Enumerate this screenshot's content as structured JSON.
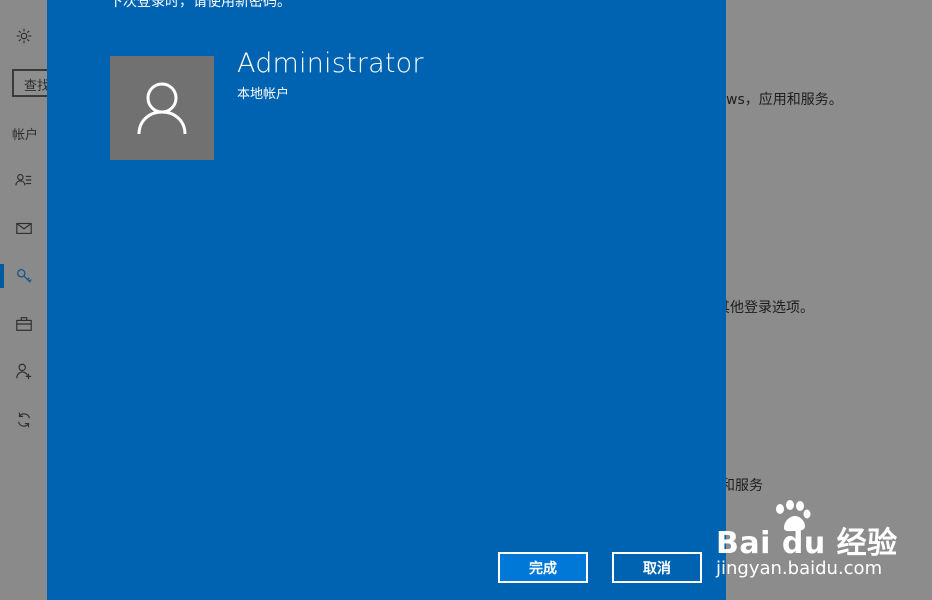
{
  "sidebar": {
    "search_text": "查找",
    "section_label": "帐户",
    "icons": [
      "gear-icon",
      "account-info-icon",
      "mail-icon",
      "key-icon",
      "briefcase-icon",
      "add-person-icon",
      "sync-icon"
    ]
  },
  "background": {
    "line1": "ws，应用和服务。",
    "line2": "其他登录选项。",
    "line3": "和服务"
  },
  "dialog": {
    "message": "下次登录时，请使用新密码。",
    "user_name": "Administrator",
    "account_type": "本地帐户",
    "finish_label": "完成",
    "cancel_label": "取消"
  },
  "watermark": {
    "logo": "Bai du 经验",
    "url": "jingyan.baidu.com"
  },
  "colors": {
    "dialog_bg": "#0063b1",
    "primary_button": "#0078d7",
    "overlay_bg": "#8c8c8c",
    "avatar_bg": "#717171"
  }
}
